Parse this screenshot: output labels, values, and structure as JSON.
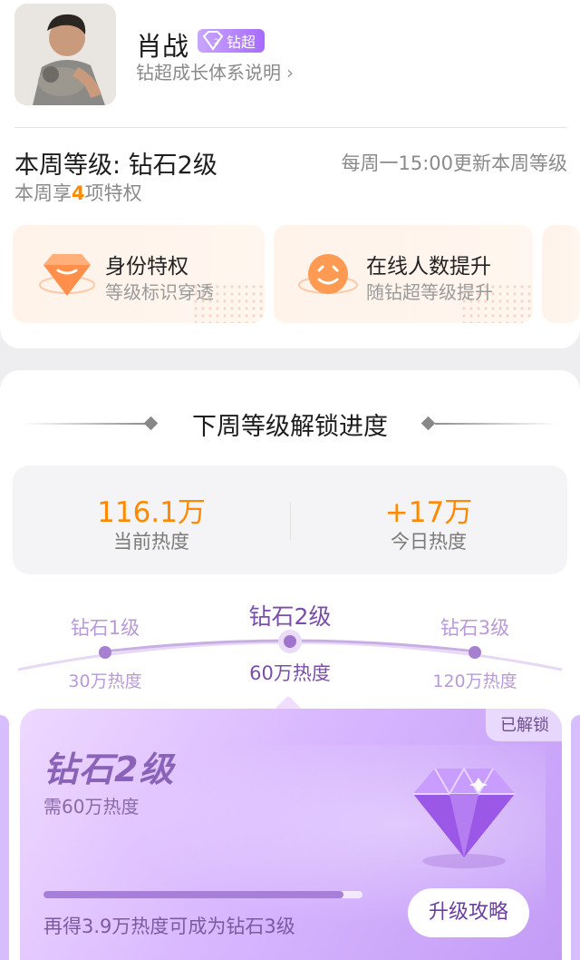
{
  "profile": {
    "name": "肖战",
    "badge_text": "钻超",
    "explain_link": "钻超成长体系说明",
    "chevron": "›"
  },
  "this_week": {
    "title": "本周等级: 钻石2级",
    "update_note": "每周一15:00更新本周等级",
    "privilege_prefix": "本周享",
    "privilege_count": "4",
    "privilege_suffix": "项特权"
  },
  "perks": [
    {
      "title": "身份特权",
      "subtitle": "等级标识穿透",
      "icon": "gem-shield-icon"
    },
    {
      "title": "在线人数提升",
      "subtitle": "随钻超等级提升",
      "icon": "smile-face-icon"
    }
  ],
  "progress": {
    "section_title": "下周等级解锁进度",
    "current_heat_value": "116.1万",
    "current_heat_label": "当前热度",
    "today_heat_value": "+17万",
    "today_heat_label": "今日热度"
  },
  "levels": [
    {
      "name": "钻石1级",
      "heat": "30万热度",
      "active": false
    },
    {
      "name": "钻石2级",
      "heat": "60万热度",
      "active": true
    },
    {
      "name": "钻石3级",
      "heat": "120万热度",
      "active": false
    }
  ],
  "level_card": {
    "status_tag": "已解锁",
    "level_name": "钻石2级",
    "requirement": "需60万热度",
    "progress_fraction": 0.94,
    "remaining_text": "再得3.9万热度可成为钻石3级",
    "guide_button": "升级攻略"
  },
  "colors": {
    "accent_orange": "#ff8a00",
    "purple": "#a66bff",
    "level_text": "#8a63b8"
  }
}
